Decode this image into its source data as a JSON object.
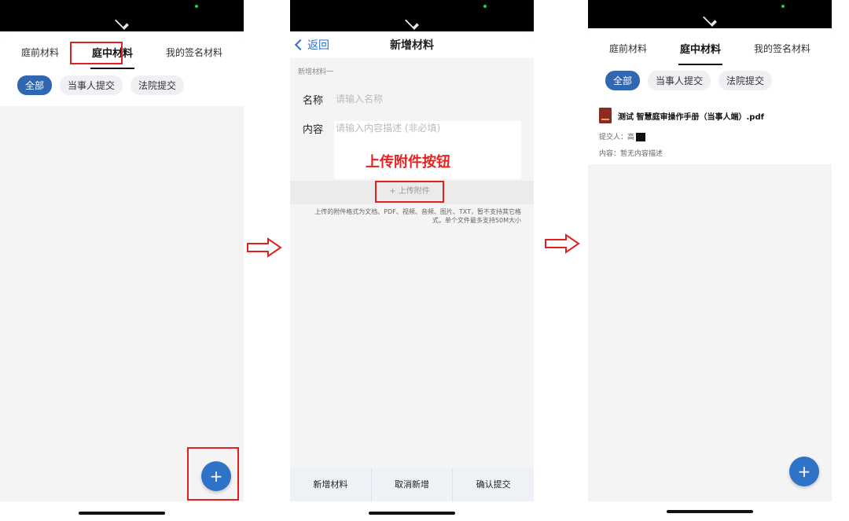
{
  "colors": {
    "accent": "#2e73c8",
    "highlight": "#e02020",
    "chip_active": "#2f67b1"
  },
  "screen1": {
    "tabs": [
      "庭前材料",
      "庭中材料",
      "我的签名材料"
    ],
    "active_tab": "庭中材料",
    "filters": [
      "全部",
      "当事人提交",
      "法院提交"
    ],
    "active_filter": "全部",
    "fab_label": "+"
  },
  "screen2": {
    "back_label": "返回",
    "title": "新增材料",
    "section_label": "新增材料一",
    "name_label": "名称",
    "name_placeholder": "请输入名称",
    "content_label": "内容",
    "content_placeholder": "请输入内容描述 (非必填)",
    "annotation": "上传附件按钮",
    "upload_button": "+ 上传附件",
    "upload_note": "上传的附件格式为文档、PDF、视频、音频、图片、TXT，暂不支持其它格式，单个文件最多支持50M大小",
    "actions": [
      "新增材料",
      "取消新增",
      "确认提交"
    ]
  },
  "screen3": {
    "tabs": [
      "庭前材料",
      "庭中材料",
      "我的签名材料"
    ],
    "active_tab": "庭中材料",
    "filters": [
      "全部",
      "当事人提交",
      "法院提交"
    ],
    "active_filter": "全部",
    "file_title": "测试 智慧庭审操作手册（当事人端）.pdf",
    "submitter_label": "提交人：高",
    "content_text": "内容：暂无内容描述",
    "fab_label": "+"
  }
}
